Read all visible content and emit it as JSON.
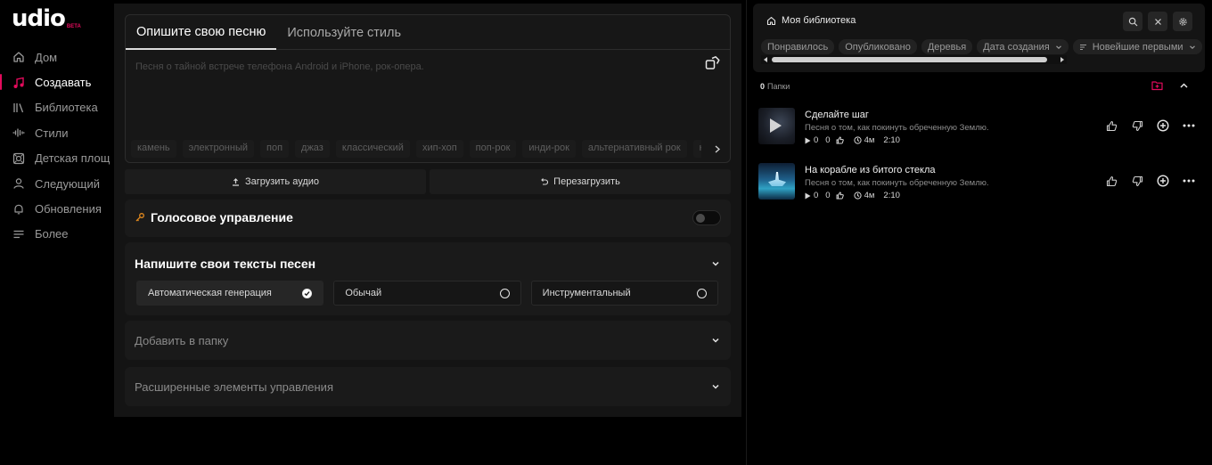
{
  "app": {
    "logo_text": "udio",
    "logo_badge": "BETA"
  },
  "sidebar": {
    "items": [
      {
        "label": "Дом",
        "icon": "home-icon"
      },
      {
        "label": "Создавать",
        "icon": "music-note-icon",
        "active": true
      },
      {
        "label": "Библиотека",
        "icon": "library-icon"
      },
      {
        "label": "Стили",
        "icon": "waveform-icon"
      },
      {
        "label": "Детская площ",
        "icon": "playground-icon"
      },
      {
        "label": "Следующий",
        "icon": "user-icon"
      },
      {
        "label": "Обновления",
        "icon": "bell-icon"
      },
      {
        "label": "Более",
        "icon": "menu-icon"
      }
    ]
  },
  "create": {
    "tabs": [
      "Опишите свою песню",
      "Используйте стиль"
    ],
    "prompt_placeholder": "Песня о тайной встрече телефона Android и iPhone, рок-опера.",
    "genre_chips": [
      "камень",
      "электронный",
      "поп",
      "джаз",
      "классический",
      "хип-хоп",
      "поп-рок",
      "инди-рок",
      "альтернативный рок",
      "народный"
    ],
    "upload_button": "Загрузить аудио",
    "reload_button": "Перезагрузить",
    "voice_control_title": "Голосовое управление",
    "lyrics_title": "Напишите свои тексты песен",
    "lyrics_options": [
      {
        "label": "Автоматическая генерация",
        "selected": true
      },
      {
        "label": "Обычай",
        "selected": false
      },
      {
        "label": "Инструментальный",
        "selected": false
      }
    ],
    "add_to_folder": "Добавить в папку",
    "advanced_controls": "Расширенные элементы управления"
  },
  "library": {
    "title": "Моя библиотека",
    "filters": [
      "Понравилось",
      "Опубликовано",
      "Деревья",
      "Дата создания",
      "Новейшие первыми"
    ],
    "folders_count": "0",
    "folders_label": "Папки",
    "tracks": [
      {
        "title": "Сделайте шаг",
        "description": "Песня о том, как покинуть обреченную Землю.",
        "plays": "0",
        "likes": "0",
        "age": "4м",
        "duration": "2:10"
      },
      {
        "title": "На корабле из битого стекла",
        "description": "Песня о том, как покинуть обреченную Землю.",
        "plays": "0",
        "likes": "0",
        "age": "4м",
        "duration": "2:10"
      }
    ]
  },
  "colors": {
    "accent": "#e30b5c",
    "background": "#000000",
    "panel": "#141414"
  }
}
